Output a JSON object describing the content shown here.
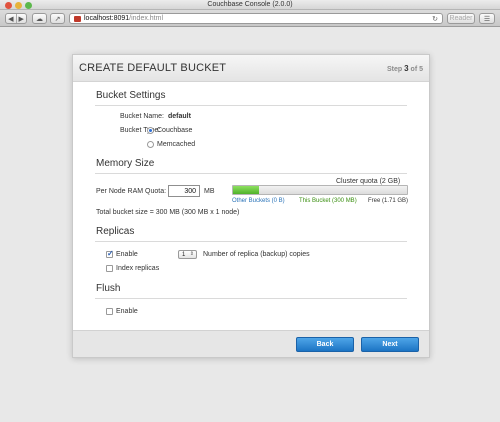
{
  "window": {
    "title": "Couchbase Console (2.0.0)"
  },
  "browser": {
    "url_host": "localhost:8091",
    "url_path": "/index.html",
    "reader_label": "Reader"
  },
  "dialog": {
    "title": "CREATE DEFAULT BUCKET",
    "step": {
      "label": "Step",
      "current": "3",
      "total": "of 5"
    },
    "bucket_settings": {
      "heading": "Bucket Settings",
      "name_label": "Bucket Name:",
      "name_value": "default",
      "type_label": "Bucket Type:",
      "options": [
        {
          "label": "Couchbase",
          "selected": true
        },
        {
          "label": "Memcached",
          "selected": false
        }
      ]
    },
    "memory_size": {
      "heading": "Memory Size",
      "quota_label": "Per Node RAM Quota:",
      "quota_value": "300",
      "quota_unit": "MB",
      "cluster_quota": "Cluster quota (2 GB)",
      "legend_other": "Other Buckets (0 B)",
      "legend_this": "This Bucket (300 MB)",
      "legend_free": "Free (1.71 GB)",
      "used_fraction": 0.147,
      "total_text": "Total bucket size = 300 MB (300 MB x 1 node)"
    },
    "replicas": {
      "heading": "Replicas",
      "enable_label": "Enable",
      "enable_checked": true,
      "copies_value": "1",
      "copies_label": "Number of replica (backup) copies",
      "index_label": "Index replicas",
      "index_checked": false
    },
    "flush": {
      "heading": "Flush",
      "enable_label": "Enable",
      "enable_checked": false
    },
    "buttons": {
      "back": "Back",
      "next": "Next"
    }
  }
}
